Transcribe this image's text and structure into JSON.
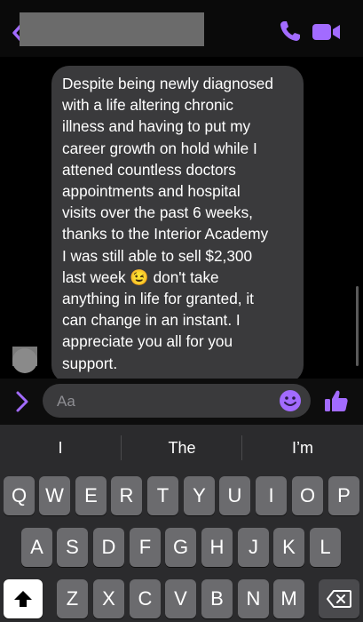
{
  "header": {
    "back_icon": "chevron-left-icon",
    "call_icon": "phone-icon",
    "video_icon": "video-camera-icon",
    "accent": "#a26bff"
  },
  "message": {
    "text": "Despite being newly diagnosed\nwith a life altering chronic\nillness and having to put my\ncareer growth on hold while I\nattened countless doctors\nappointments and hospital\nvisits over the past 6 weeks,\nthanks to the Interior Academy\nI was still able to sell $2,300\nlast week 😉 don't take\nanything in life for granted, it\ncan change in an instant. I\nappreciate you all for you\nsupport."
  },
  "composer": {
    "placeholder": "Aa",
    "expand_icon": "chevron-right-icon",
    "emoji_icon": "emoji-icon",
    "like_icon": "thumbs-up-icon"
  },
  "keyboard": {
    "suggestions": [
      "I",
      "The",
      "I’m"
    ],
    "row1": [
      "Q",
      "W",
      "E",
      "R",
      "T",
      "Y",
      "U",
      "I",
      "O",
      "P"
    ],
    "row2": [
      "A",
      "S",
      "D",
      "F",
      "G",
      "H",
      "J",
      "K",
      "L"
    ],
    "row3": [
      "Z",
      "X",
      "C",
      "V",
      "B",
      "N",
      "M"
    ],
    "shift_icon": "shift-arrow-icon",
    "delete_icon": "backspace-icon"
  }
}
